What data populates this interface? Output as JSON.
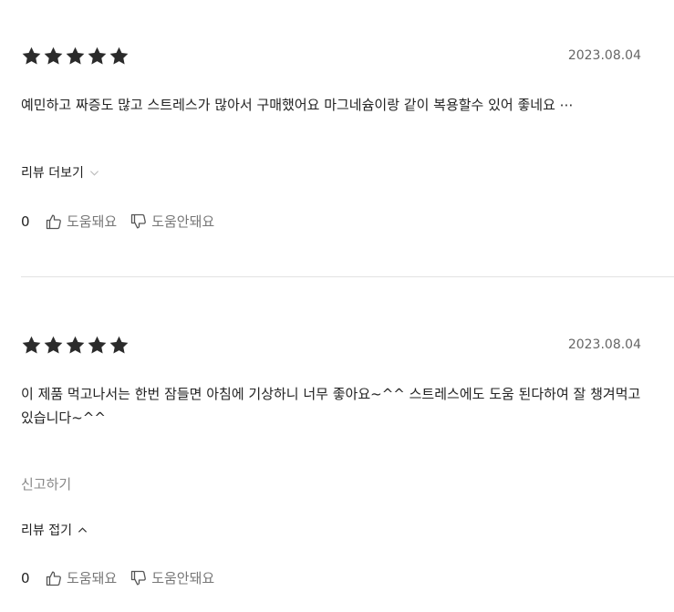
{
  "reviews": [
    {
      "rating": 5,
      "date": "2023.08.04",
      "text": "예민하고 짜증도 많고 스트레스가 많아서 구매했어요 마그네슘이랑 같이 복용할수 있어 좋네요 ⋯",
      "toggle_label": "리뷰 더보기",
      "toggle_icon": "chevron-down-icon",
      "helpful_count": "0",
      "helpful_label": "도움돼요",
      "unhelpful_label": "도움안돼요"
    },
    {
      "rating": 5,
      "date": "2023.08.04",
      "text": "이 제품 먹고나서는 한번 잠들면 아침에 기상하니 너무 좋아요~^^ 스트레스에도 도움 된다하여 잘 챙겨먹고 있습니다~^^",
      "report_label": "신고하기",
      "toggle_label": "리뷰 접기",
      "toggle_icon": "chevron-up-icon",
      "helpful_count": "0",
      "helpful_label": "도움돼요",
      "unhelpful_label": "도움안돼요"
    }
  ],
  "colors": {
    "star": "#2b2b2b",
    "text": "#222222",
    "muted": "#777777",
    "divider": "#e2e2e2"
  }
}
